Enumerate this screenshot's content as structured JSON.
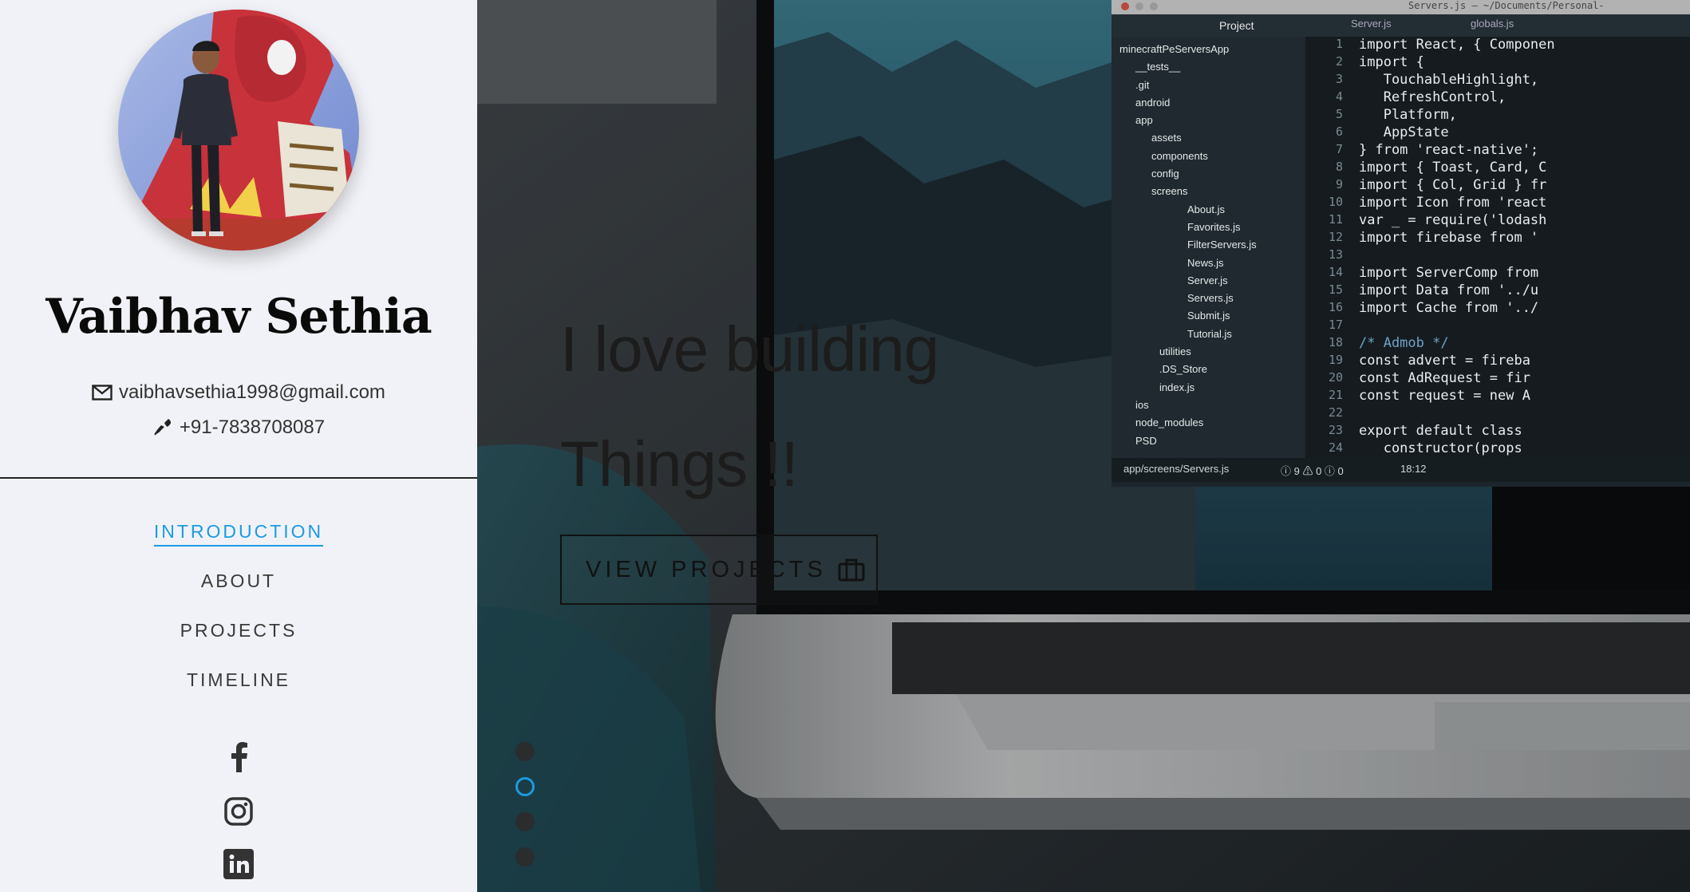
{
  "profile": {
    "name": "Vaibhav Sethia",
    "email": "vaibhavsethia1998@gmail.com",
    "phone": "+91-7838708087",
    "avatar_icon": "profile-photo"
  },
  "nav": {
    "items": [
      {
        "label": "INTRODUCTION",
        "active": true
      },
      {
        "label": "ABOUT",
        "active": false
      },
      {
        "label": "PROJECTS",
        "active": false
      },
      {
        "label": "TIMELINE",
        "active": false
      }
    ]
  },
  "social": {
    "facebook_icon": "facebook-icon",
    "instagram_icon": "instagram-icon",
    "linkedin_icon": "linkedin-icon"
  },
  "hero": {
    "headline_line1": "I love building",
    "headline_line2": "Things !!",
    "cta_label": "VIEW PROJECTS",
    "cta_icon": "briefcase-icon",
    "slide_count": 4,
    "active_slide": 2
  },
  "code_window": {
    "title": "Servers.js — ~/Documents/Personal-",
    "panel_title": "Project",
    "tabs": [
      "Server.js",
      "globals.js"
    ],
    "tree": [
      "minecraftPeServersApp",
      "__tests__",
      ".git",
      "android",
      "app",
      "assets",
      "components",
      "config",
      "screens",
      "About.js",
      "Favorites.js",
      "FilterServers.js",
      "News.js",
      "Server.js",
      "Servers.js",
      "Submit.js",
      "Tutorial.js",
      "utilities",
      ".DS_Store",
      "index.js",
      "ios",
      "node_modules",
      "PSD"
    ],
    "line_numbers": [
      "1",
      "2",
      "3",
      "4",
      "5",
      "6",
      "7",
      "8",
      "9",
      "10",
      "11",
      "12",
      "13",
      "14",
      "15",
      "16",
      "17",
      "18",
      "19",
      "20",
      "21",
      "22",
      "23",
      "24"
    ],
    "code_lines": [
      "import React, { Componen",
      "import {",
      "   TouchableHighlight,",
      "   RefreshControl,",
      "   Platform,",
      "   AppState",
      "} from 'react-native';",
      "import { Toast, Card, C",
      "import { Col, Grid } fr",
      "import Icon from 'react",
      "var _ = require('lodash",
      "import firebase from '",
      "",
      "import ServerComp from",
      "import Data from '../u",
      "import Cache from '../",
      "",
      "/* Admob */",
      "const advert = fireba",
      "const AdRequest = fir",
      "const request = new A",
      "",
      "export default class",
      "   constructor(props"
    ],
    "status_path": "app/screens/Servers.js",
    "status_counts": "ⓘ 9 ⚠ 0 ⓘ 0",
    "status_time": "18:12"
  },
  "colors": {
    "accent": "#1b9be3",
    "sidebar_bg": "#f1f2f7",
    "text_dark": "#111111"
  }
}
